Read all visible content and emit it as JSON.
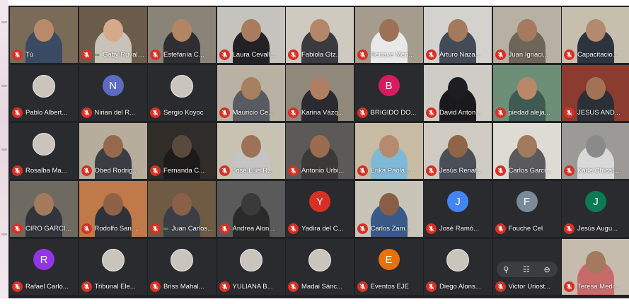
{
  "theme": {
    "tile_bg": "#3c4043",
    "mute_color": "#d93025",
    "meet_bg": "#202124"
  },
  "participants": [
    {
      "name": "Tú",
      "type": "video",
      "bg": "#7a6a58",
      "skin": "#b8896a",
      "shirt": "#3b4a63"
    },
    {
      "name": "Gaby Ruvalc...",
      "type": "video",
      "bg": "#6b5b4a",
      "skin": "#d6a98a",
      "shirt": "#c9c2b8",
      "speaking": true
    },
    {
      "name": "Estefanía C...",
      "type": "video",
      "bg": "#8a8478",
      "skin": "#b38565",
      "shirt": "#2e2e33"
    },
    {
      "name": "Laura Cevall...",
      "type": "video",
      "bg": "#c4c3be",
      "skin": "#a97c5f",
      "shirt": "#222226"
    },
    {
      "name": "Fabiola Gtz.",
      "type": "video",
      "bg": "#cfcac0",
      "skin": "#b48566",
      "shirt": "#3a3a40"
    },
    {
      "name": "Setrave Meri...",
      "type": "video",
      "bg": "#a59c8e",
      "skin": "#9c7156",
      "shirt": "#e8e8e8"
    },
    {
      "name": "Arturo Naza...",
      "type": "video",
      "bg": "#d4d2ce",
      "skin": "#a47a5c",
      "shirt": "#444b58"
    },
    {
      "name": "Juan Ignaci...",
      "type": "video",
      "bg": "#b8b0a2",
      "skin": "#a57a5e",
      "shirt": "#6d6558"
    },
    {
      "name": "Capacitacio...",
      "type": "video",
      "bg": "#c7bfae",
      "skin": "#b38a6c",
      "shirt": "#2c3440"
    },
    {
      "name": "Pablo Albert...",
      "type": "avatar",
      "avatar_photo": true,
      "initial": ""
    },
    {
      "name": "Nirian del R...",
      "type": "avatar",
      "initial": "N",
      "color": "#5c6bc0"
    },
    {
      "name": "Sergio Koyoc",
      "type": "avatar",
      "avatar_photo": true,
      "initial": ""
    },
    {
      "name": "Mauricio Ce...",
      "type": "video",
      "bg": "#b9b2a4",
      "skin": "#a7805f",
      "shirt": "#585b62"
    },
    {
      "name": "Karina Vázq...",
      "type": "video",
      "bg": "#8f887b",
      "skin": "#b07f62",
      "shirt": "#2a2a30"
    },
    {
      "name": "BRIGIDO DO...",
      "type": "avatar",
      "initial": "B",
      "color": "#d81b60"
    },
    {
      "name": "David Anton...",
      "type": "video",
      "bg": "#cfccc6",
      "skin": "#1e1e22",
      "shirt": "#1a1a1d"
    },
    {
      "name": "piedad aleja...",
      "type": "video",
      "bg": "#6d8f78",
      "skin": "#b9886a",
      "shirt": "#3f5a52"
    },
    {
      "name": "JESUS AND...",
      "type": "video",
      "bg": "#8c3b2f",
      "skin": "#a27255",
      "shirt": "#2b2f36"
    },
    {
      "name": "Rosalba Ma...",
      "type": "avatar",
      "avatar_photo": true,
      "initial": ""
    },
    {
      "name": "Obed Rodrig...",
      "type": "video",
      "bg": "#b7ad9c",
      "skin": "#96694d",
      "shirt": "#3a3d43"
    },
    {
      "name": "Fernanda C...",
      "type": "video",
      "bg": "#2f2c29",
      "skin": "#5a4a3e",
      "shirt": "#1c1b1a"
    },
    {
      "name": "José Luis R...",
      "type": "video",
      "bg": "#c8c2b3",
      "skin": "#9d7257",
      "shirt": "#c4c4c4"
    },
    {
      "name": "Antonio Urbi...",
      "type": "video",
      "bg": "#5b5a58",
      "skin": "#9a6c50",
      "shirt": "#3b3a39"
    },
    {
      "name": "Erika Paola ...",
      "type": "video",
      "bg": "#c7bba4",
      "skin": "#b58a6d",
      "shirt": "#7fb9d8"
    },
    {
      "name": "Jesús Renat...",
      "type": "video",
      "bg": "#cfcbc3",
      "skin": "#8e6549",
      "shirt": "#4a4e56"
    },
    {
      "name": "Carlos Garci...",
      "type": "video",
      "bg": "#dedbd4",
      "skin": "#a27a5e",
      "shirt": "#5a5a5c"
    },
    {
      "name": "Karla Chicat...",
      "type": "video",
      "bg": "#9c9a96",
      "skin": "#8a8a8a",
      "shirt": "#d9d9d9"
    },
    {
      "name": "CIRO GARCI...",
      "type": "video",
      "bg": "#6e6a62",
      "skin": "#a37a5c",
      "shirt": "#32353b"
    },
    {
      "name": "Rodolfo San...",
      "type": "video",
      "bg": "#c07a4a",
      "skin": "#8f6247",
      "shirt": "#2f3238"
    },
    {
      "name": "Juan Carlos...",
      "type": "video",
      "bg": "#6f5a44",
      "skin": "#8b6048",
      "shirt": "#3b3f45",
      "speaking": true
    },
    {
      "name": "Andrea Alon...",
      "type": "video",
      "bg": "#5a5a5a",
      "skin": "#3a3a3a",
      "shirt": "#2a2a2a"
    },
    {
      "name": "Yadira del C...",
      "type": "avatar",
      "initial": "Y",
      "color": "#d93025"
    },
    {
      "name": "Carlos Zam...",
      "type": "video",
      "bg": "#c9c4b8",
      "skin": "#8a5e45",
      "shirt": "#3a5a8a"
    },
    {
      "name": "José Ramó...",
      "type": "avatar",
      "initial": "J",
      "color": "#4285f4"
    },
    {
      "name": "Fouche Cel",
      "type": "avatar",
      "initial": "F",
      "color": "#7b8a99"
    },
    {
      "name": "Jesús Augu...",
      "type": "avatar",
      "initial": "J",
      "color": "#0b7a55"
    },
    {
      "name": "Rafael Carlo...",
      "type": "avatar",
      "initial": "R",
      "color": "#9334e6"
    },
    {
      "name": "Tribunal Ele...",
      "type": "avatar",
      "avatar_photo": true,
      "initial": ""
    },
    {
      "name": "Briss Mahal...",
      "type": "avatar",
      "avatar_photo": true,
      "initial": ""
    },
    {
      "name": "YULIANA B...",
      "type": "avatar",
      "avatar_photo": true,
      "initial": ""
    },
    {
      "name": "Madai Sánc...",
      "type": "avatar",
      "avatar_photo": true,
      "initial": ""
    },
    {
      "name": "Eventos EJE",
      "type": "avatar",
      "initial": "E",
      "color": "#e8710a"
    },
    {
      "name": "Diego Alons...",
      "type": "avatar",
      "avatar_photo": true,
      "initial": ""
    },
    {
      "name": "Victor Uriost...",
      "type": "controls",
      "initial": ""
    },
    {
      "name": "Teresa Medi...",
      "type": "video",
      "bg": "#c6bcae",
      "skin": "#a37a5c",
      "shirt": "#c96a6a"
    }
  ]
}
